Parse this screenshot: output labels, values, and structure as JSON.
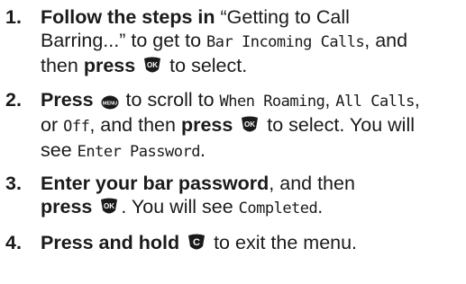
{
  "steps": [
    {
      "number": "1.",
      "line1_bold": "Follow the steps in",
      "line1_text": " “Getting to Call",
      "line2_text": "Barring...” to get to ",
      "line2_lcd": "Bar Incoming Calls",
      "line2_tail": ", and",
      "line3_pre": "then ",
      "line3_bold": "press",
      "line3_icon": "ok-key-icon",
      "line3_tail": " to select."
    },
    {
      "number": "2.",
      "line1_bold": "Press",
      "line1_icon": "menu-key-icon",
      "line1_text": " to scroll to ",
      "line1_lcd_a": "When Roaming",
      "line1_sep_a": ", ",
      "line1_lcd_b": "All Calls",
      "line1_sep_b": ",",
      "line2_pre": "or ",
      "line2_lcd": "Off",
      "line2_text": ", and then ",
      "line2_bold": "press",
      "line2_icon": "ok-key-icon",
      "line2_tail": " to select. You will",
      "line3_pre": "see ",
      "line3_lcd": "Enter Password",
      "line3_tail": "."
    },
    {
      "number": "3.",
      "line1_bold": "Enter your bar password",
      "line1_tail": ", and then",
      "line2_bold": "press",
      "line2_icon": "ok-key-icon",
      "line2_text": ". You will see ",
      "line2_lcd": "Completed",
      "line2_tail": "."
    },
    {
      "number": "4.",
      "line1_bold": "Press and hold",
      "line1_icon": "clear-key-icon",
      "line1_tail": " to exit the menu."
    }
  ],
  "icons": {
    "ok_label": "OK",
    "menu_label": "MENU",
    "clear_label": "C"
  },
  "colors": {
    "text": "#1a1a1a",
    "key_fill": "#1a1a1a",
    "key_label": "#ffffff"
  }
}
